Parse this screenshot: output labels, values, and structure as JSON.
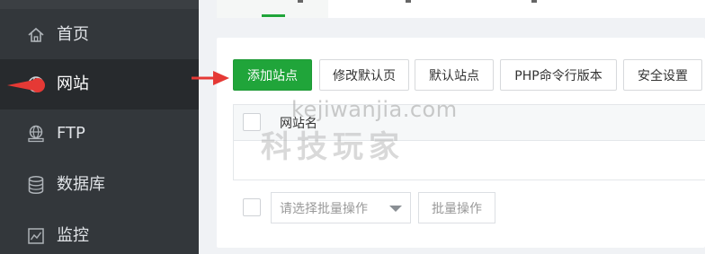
{
  "sidebar": {
    "items": [
      {
        "label": "首页",
        "icon": "home-icon"
      },
      {
        "label": "网站",
        "icon": "globe-icon",
        "active": true
      },
      {
        "label": "FTP",
        "icon": "ftp-icon"
      },
      {
        "label": "数据库",
        "icon": "database-icon"
      },
      {
        "label": "监控",
        "icon": "monitor-icon"
      }
    ]
  },
  "toolbar": {
    "add_site": "添加站点",
    "edit_default_page": "修改默认页",
    "default_site": "默认站点",
    "php_cli_version": "PHP命令行版本",
    "security_settings": "安全设置"
  },
  "table": {
    "columns": [
      "网站名"
    ]
  },
  "batch": {
    "select_placeholder": "请选择批量操作",
    "action_label": "批量操作"
  },
  "watermark": {
    "en": "kejiwanjia.com",
    "cn": "科技玩家"
  },
  "colors": {
    "sidebar_bg": "#33373b",
    "sidebar_active_bg": "#272a2d",
    "primary": "#20a53a",
    "annotation_arrow": "#e53935"
  }
}
